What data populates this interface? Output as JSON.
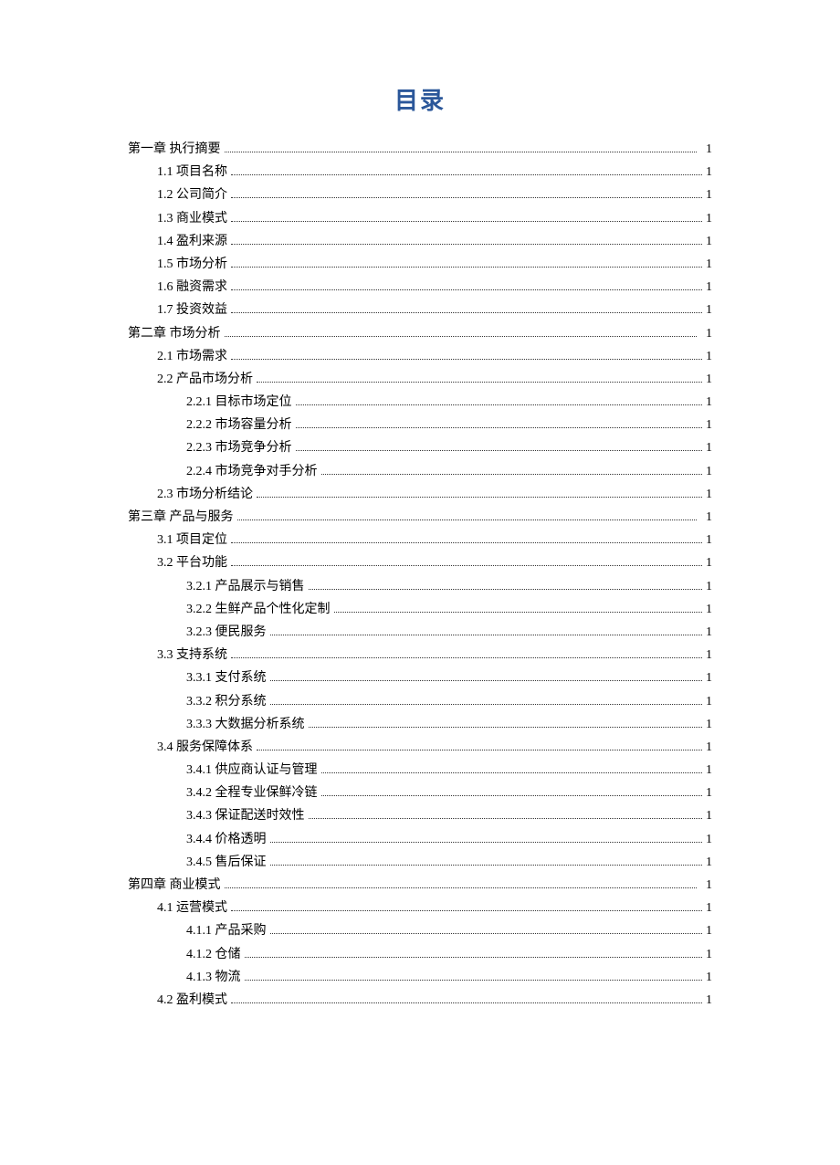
{
  "title": "目录",
  "entries": [
    {
      "level": 1,
      "label": "第一章  执行摘要",
      "page": "1"
    },
    {
      "level": 2,
      "label": "1.1 项目名称",
      "page": "1"
    },
    {
      "level": 2,
      "label": "1.2 公司简介",
      "page": "1"
    },
    {
      "level": 2,
      "label": "1.3 商业模式",
      "page": "1"
    },
    {
      "level": 2,
      "label": "1.4 盈利来源",
      "page": "1"
    },
    {
      "level": 2,
      "label": "1.5 市场分析",
      "page": "1"
    },
    {
      "level": 2,
      "label": "1.6 融资需求",
      "page": "1"
    },
    {
      "level": 2,
      "label": "1.7 投资效益",
      "page": "1"
    },
    {
      "level": 1,
      "label": "第二章  市场分析",
      "page": "1"
    },
    {
      "level": 2,
      "label": "2.1 市场需求",
      "page": "1"
    },
    {
      "level": 2,
      "label": "2.2 产品市场分析",
      "page": "1"
    },
    {
      "level": 3,
      "label": "2.2.1 目标市场定位",
      "page": "1"
    },
    {
      "level": 3,
      "label": "2.2.2 市场容量分析",
      "page": "1"
    },
    {
      "level": 3,
      "label": "2.2.3 市场竞争分析",
      "page": "1"
    },
    {
      "level": 3,
      "label": "2.2.4 市场竞争对手分析",
      "page": "1"
    },
    {
      "level": 2,
      "label": "2.3 市场分析结论",
      "page": "1"
    },
    {
      "level": 1,
      "label": "第三章  产品与服务",
      "page": "1"
    },
    {
      "level": 2,
      "label": "3.1 项目定位",
      "page": "1"
    },
    {
      "level": 2,
      "label": "3.2 平台功能",
      "page": "1"
    },
    {
      "level": 3,
      "label": "3.2.1 产品展示与销售",
      "page": "1"
    },
    {
      "level": 3,
      "label": "3.2.2 生鲜产品个性化定制",
      "page": "1"
    },
    {
      "level": 3,
      "label": "3.2.3 便民服务",
      "page": "1"
    },
    {
      "level": 2,
      "label": "3.3 支持系统",
      "page": "1"
    },
    {
      "level": 3,
      "label": "3.3.1 支付系统",
      "page": "1"
    },
    {
      "level": 3,
      "label": "3.3.2 积分系统",
      "page": "1"
    },
    {
      "level": 3,
      "label": "3.3.3 大数据分析系统",
      "page": "1"
    },
    {
      "level": 2,
      "label": "3.4 服务保障体系",
      "page": "1"
    },
    {
      "level": 3,
      "label": "3.4.1 供应商认证与管理",
      "page": "1"
    },
    {
      "level": 3,
      "label": "3.4.2 全程专业保鲜冷链",
      "page": "1"
    },
    {
      "level": 3,
      "label": "3.4.3 保证配送时效性",
      "page": "1"
    },
    {
      "level": 3,
      "label": "3.4.4 价格透明",
      "page": "1"
    },
    {
      "level": 3,
      "label": "3.4.5 售后保证",
      "page": "1"
    },
    {
      "level": 1,
      "label": "第四章  商业模式",
      "page": "1"
    },
    {
      "level": 2,
      "label": "4.1 运营模式",
      "page": "1"
    },
    {
      "level": 3,
      "label": "4.1.1 产品采购",
      "page": "1"
    },
    {
      "level": 3,
      "label": "4.1.2 仓储",
      "page": "1"
    },
    {
      "level": 3,
      "label": "4.1.3 物流",
      "page": "1"
    },
    {
      "level": 2,
      "label": "4.2 盈利模式",
      "page": "1"
    }
  ]
}
